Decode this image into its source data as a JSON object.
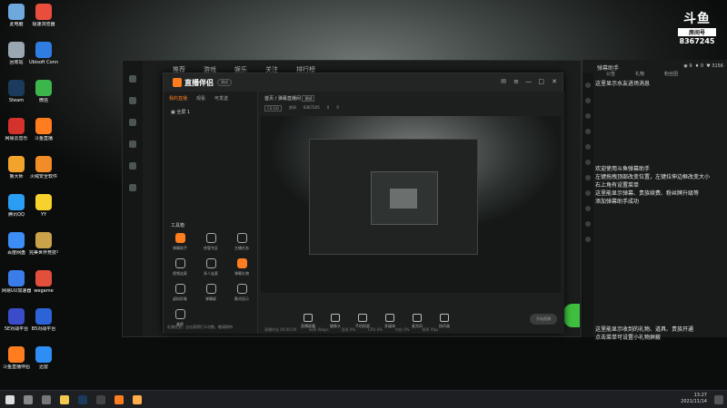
{
  "desktop": {
    "icons": [
      {
        "label": "此电脑",
        "color": "#6fa8dc"
      },
      {
        "label": "极速浏览器",
        "color": "#e94e3c"
      },
      {
        "label": "回收站",
        "color": "#9aa7b2"
      },
      {
        "label": "Ubisoft Connect",
        "color": "#2f7de1"
      },
      {
        "label": "Steam",
        "color": "#1b3a5c"
      },
      {
        "label": "微信",
        "color": "#3cb54a"
      },
      {
        "label": "网易云音乐",
        "color": "#d5322c"
      },
      {
        "label": "斗鱼直播",
        "color": "#ff7c1f"
      },
      {
        "label": "鲁大师",
        "color": "#f3a32c"
      },
      {
        "label": "火绒安全软件",
        "color": "#f28c28"
      },
      {
        "label": "腾讯QQ",
        "color": "#2a9df4"
      },
      {
        "label": "YY",
        "color": "#f7d12c"
      },
      {
        "label": "百度网盘",
        "color": "#3c8df5"
      },
      {
        "label": "完美世界竞技平台",
        "color": "#c9a24a"
      },
      {
        "label": "网易UU加速器",
        "color": "#3b7de8"
      },
      {
        "label": "wegame",
        "color": "#e24f3b"
      },
      {
        "label": "5E对战平台",
        "color": "#3a4cc9"
      },
      {
        "label": "B5对战平台",
        "color": "#2c64d8"
      },
      {
        "label": "斗鱼直播伴侣",
        "color": "#ff7c1f"
      },
      {
        "label": "迅雷",
        "color": "#2f8ef5"
      }
    ]
  },
  "brand": {
    "logo": "斗鱼",
    "label": "房间号",
    "room": "8367245"
  },
  "bg_tabs": [
    "推荐",
    "游戏",
    "娱乐",
    "关注",
    "排行榜"
  ],
  "right_panel": {
    "title": "弹幕助手",
    "stats": [
      "9",
      "0",
      "3156"
    ],
    "tabs": [
      "公告",
      "礼物",
      "粉丝团"
    ],
    "messages": [
      "这里显示水友进场消息",
      "欢迎使用斗鱼弹幕助手",
      "左键拖拽顶部改变位置，左键拉伸边框改变大小",
      "右上角有设置菜单",
      "这里能显示弹幕、贵族续费、粉丝牌升级等",
      "添加弹幕助手成功",
      "这里能显示收到的礼物、道具、贵族开通",
      "点击菜单可设置小礼物屏蔽"
    ]
  },
  "window": {
    "app_title": "直播伴侣",
    "version": "测试",
    "left_tabs": [
      "我的直播",
      "观看",
      "可发送"
    ],
    "scene": "全屏 1",
    "tools_title": "工具箱",
    "tools": [
      "弹幕助手",
      "房管专区",
      "主播任务",
      "视频连麦",
      "多人连麦",
      "弹幕礼物",
      "虚拟形象",
      "弹幕姬",
      "歌词显示",
      "美颜"
    ],
    "footer": "礼物任务，点击获得打卡次数，敬请期待",
    "crumb": "首页 / 弹幕直播间",
    "crumb_tag": "测试",
    "info": {
      "game": "CS:GO",
      "room_tag": "房间",
      "room": "8367245",
      "likes": "0",
      "hot": "0"
    },
    "controls": [
      "直播屏幕",
      "摄像头",
      "手机投屏",
      "多媒体",
      "麦克风",
      "扬声器"
    ],
    "start_label": "开始直播",
    "status": [
      "直播时长 00:00:00",
      "码率 0kbps",
      "丢帧 0%",
      "CPU 0%",
      "内存 0%",
      "帧率 0fps"
    ]
  },
  "taskbar": {
    "time": "13:27",
    "date": "2021/11/14"
  }
}
